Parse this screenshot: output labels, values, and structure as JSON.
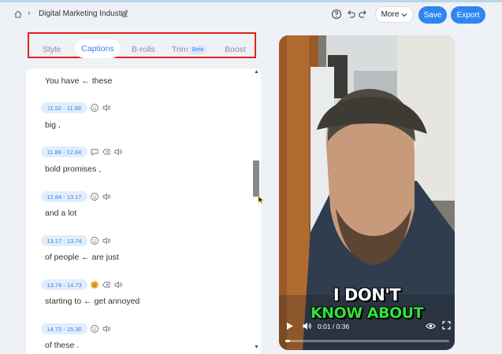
{
  "header": {
    "title": "Digital Marketing Industry",
    "more_label": "More",
    "save_label": "Save",
    "export_label": "Export",
    "icons": [
      "home-icon",
      "chevron-right-icon",
      "edit-icon",
      "help-icon",
      "undo-icon",
      "redo-icon",
      "chevron-down-icon"
    ]
  },
  "tabs": [
    {
      "label": "Style"
    },
    {
      "label": "Captions",
      "active": true
    },
    {
      "label": "B-rolls"
    },
    {
      "label": "Trim",
      "badge": "Beta"
    },
    {
      "label": "Boost"
    }
  ],
  "captions": [
    {
      "text": "You have ← these"
    },
    {
      "time": "11.52  -  11.88",
      "text": "big ,"
    },
    {
      "time": "11.88  -  12.84",
      "text": "bold promises ,"
    },
    {
      "time": "12.84  -  13.17",
      "text": "and a lot"
    },
    {
      "time": "13.17  -  13.74",
      "text": "of people ← are just"
    },
    {
      "time": "13.74  -  14.73",
      "text": "starting to ← get annoyed"
    },
    {
      "time": "14.73  -  15.36",
      "text": "of these ."
    }
  ],
  "video": {
    "subtitle_line1": "I DON'T",
    "subtitle_line2": "KNOW ABOUT",
    "time": "0:01 / 0:36",
    "progress": 0.03
  },
  "colors": {
    "accent": "#2e86f0",
    "highlight_box": "#e2231a",
    "subtitle_green": "#2ee23a"
  }
}
